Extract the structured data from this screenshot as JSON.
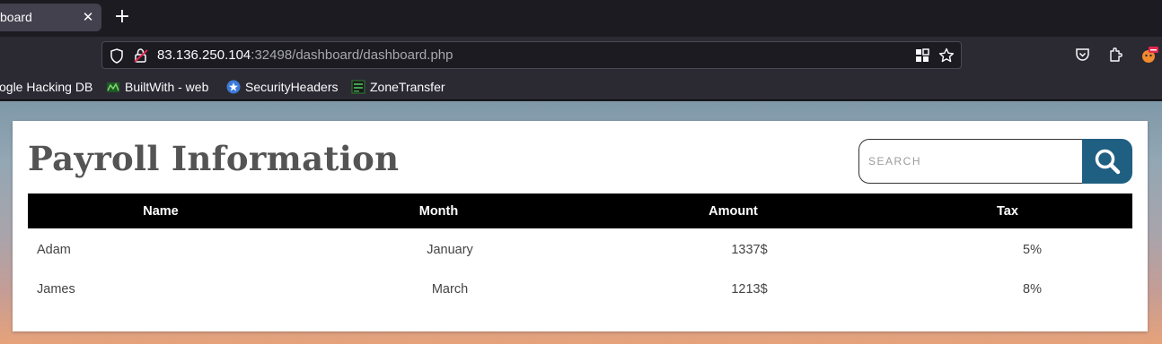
{
  "browser": {
    "tab_title": "board",
    "tab_close_glyph": "✕",
    "new_tab_glyph": "+",
    "url_host": "83.136.250.104",
    "url_path": ":32498/dashboard/dashboard.php",
    "bookmarks": [
      {
        "label": "ogle Hacking DB",
        "icon": null
      },
      {
        "label": "BuiltWith - web",
        "icon": "builtwith-icon"
      },
      {
        "label": "SecurityHeaders",
        "icon": "securityheaders-icon"
      },
      {
        "label": "ZoneTransfer",
        "icon": "zonetransfer-icon"
      }
    ]
  },
  "page": {
    "title": "Payroll Information",
    "search": {
      "placeholder": "SEARCH",
      "value": ""
    },
    "table": {
      "headers": [
        "Name",
        "Month",
        "Amount",
        "Tax"
      ],
      "rows": [
        [
          "Adam",
          "January",
          "1337$",
          "5%"
        ],
        [
          "James",
          "March",
          "1213$",
          "8%"
        ]
      ]
    }
  },
  "colors": {
    "accent": "#1f5f82",
    "table_header_bg": "#000000",
    "title_text": "#545454"
  }
}
